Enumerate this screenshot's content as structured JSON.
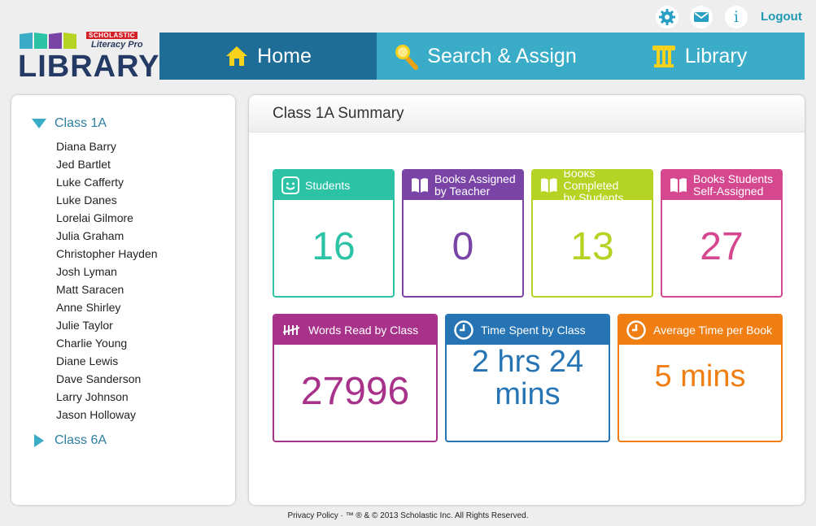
{
  "header": {
    "logo": {
      "brand": "SCHOLASTIC",
      "product": "Literacy Pro",
      "title": "LIBRARY"
    },
    "utility": {
      "settings_icon": "gear-icon",
      "mail_icon": "mail-icon",
      "info_icon": "info-icon",
      "info_glyph": "i",
      "logout_label": "Logout"
    }
  },
  "nav": {
    "home": {
      "label": "Home",
      "icon": "house-icon"
    },
    "search": {
      "label": "Search & Assign",
      "icon": "magnifier-icon"
    },
    "library": {
      "label": "Library",
      "icon": "column-icon"
    }
  },
  "sidebar": {
    "classes": [
      {
        "name": "Class 1A",
        "expanded": true,
        "students": [
          "Diana Barry",
          "Jed Bartlet",
          "Luke Cafferty",
          "Luke Danes",
          "Lorelai Gilmore",
          "Julia Graham",
          "Christopher Hayden",
          "Josh Lyman",
          "Matt Saracen",
          "Anne Shirley",
          "Julie Taylor",
          "Charlie Young",
          "Diane Lewis",
          "Dave Sanderson",
          "Larry Johnson",
          "Jason Holloway"
        ]
      },
      {
        "name": "Class 6A",
        "expanded": false
      }
    ]
  },
  "main": {
    "title": "Class 1A Summary",
    "cards": {
      "students": {
        "label": "Students",
        "value": "16",
        "color": "#2cc2a6"
      },
      "assigned": {
        "label_line1": "Books Assigned",
        "label_line2": "by Teacher",
        "value": "0",
        "color": "#7a44a6"
      },
      "completed": {
        "label_line1": "Books Completed",
        "label_line2": "by Students",
        "value": "13",
        "color": "#b5d322"
      },
      "self_assigned": {
        "label_line1": "Books Students",
        "label_line2": "Self-Assigned",
        "value": "27",
        "color": "#d5488f"
      },
      "words": {
        "label": "Words Read by Class",
        "value": "27996",
        "color": "#a8318a"
      },
      "time": {
        "label": "Time Spent by Class",
        "value_line1": "2 hrs 24",
        "value_line2": "mins",
        "color": "#2674b3"
      },
      "avg": {
        "label": "Average Time per Book",
        "value": "5 mins",
        "color": "#f07e13"
      }
    }
  },
  "footer": {
    "privacy_label": "Privacy Policy",
    "copyright": " · ™ ® & © 2013 Scholastic Inc. All Rights Reserved."
  }
}
